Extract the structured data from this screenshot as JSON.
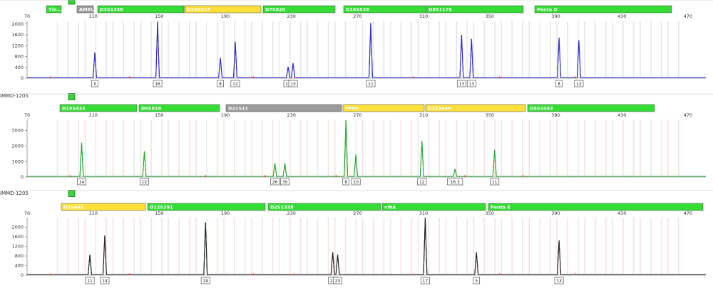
{
  "panels": [
    {
      "sample": "IMMD-1205",
      "color": "#2b2bc8",
      "markers": [
        {
          "label": "Yin...",
          "status": "green"
        },
        {
          "label": "AMEL",
          "status": "gray"
        },
        {
          "label": "D3S1358",
          "status": "green"
        },
        {
          "label": "D13S317",
          "status": "yellow"
        },
        {
          "label": "D7S820",
          "status": "green"
        },
        {
          "label": "D16S539",
          "status": "green"
        },
        {
          "label": "D8S1179",
          "status": "green"
        },
        {
          "label": "Penta D",
          "status": "green"
        }
      ],
      "x_ticks": [
        "70",
        "110",
        "150",
        "190",
        "230",
        "270",
        "310",
        "350",
        "390",
        "430",
        "470"
      ],
      "y_ticks": [
        "2000",
        "1600",
        "1200",
        "800",
        "400",
        "0"
      ],
      "ylim": [
        0,
        2100
      ],
      "peaks": [
        {
          "x": 111,
          "y": 950,
          "allele": "X"
        },
        {
          "x": 149,
          "y": 2100,
          "allele": "16"
        },
        {
          "x": 187,
          "y": 750,
          "allele": "8"
        },
        {
          "x": 196,
          "y": 1350,
          "allele": "12"
        },
        {
          "x": 228,
          "y": 420,
          "allele": "12"
        },
        {
          "x": 231,
          "y": 560,
          "allele": "13"
        },
        {
          "x": 278,
          "y": 2050,
          "allele": "11"
        },
        {
          "x": 333,
          "y": 1600,
          "allele": "13"
        },
        {
          "x": 339,
          "y": 1450,
          "allele": "13"
        },
        {
          "x": 392,
          "y": 1500,
          "allele": "8"
        },
        {
          "x": 404,
          "y": 1400,
          "allele": "12"
        }
      ]
    },
    {
      "sample": "IMMD-1205",
      "color": "#22aa33",
      "markers": [
        {
          "label": "D19S433",
          "status": "green"
        },
        {
          "label": "D5S818",
          "status": "green"
        },
        {
          "label": "D21S11",
          "status": "gray"
        },
        {
          "label": "TPOX",
          "status": "yellow"
        },
        {
          "label": "D1S1656",
          "status": "yellow"
        },
        {
          "label": "D6S1043",
          "status": "green"
        }
      ],
      "x_ticks": [
        "70",
        "110",
        "150",
        "190",
        "230",
        "270",
        "310",
        "350",
        "390",
        "430",
        "470"
      ],
      "y_ticks": [
        "3000",
        "2000",
        "1000",
        "0"
      ],
      "ylim": [
        0,
        3700
      ],
      "peaks": [
        {
          "x": 103,
          "y": 2200,
          "allele": "14"
        },
        {
          "x": 141,
          "y": 1650,
          "allele": "12"
        },
        {
          "x": 220,
          "y": 880,
          "allele": "26"
        },
        {
          "x": 226,
          "y": 880,
          "allele": "30"
        },
        {
          "x": 263,
          "y": 3650,
          "allele": "8"
        },
        {
          "x": 269,
          "y": 1450,
          "allele": "10"
        },
        {
          "x": 309,
          "y": 2300,
          "allele": "12"
        },
        {
          "x": 329,
          "y": 520,
          "allele": "16.3"
        },
        {
          "x": 353,
          "y": 1750,
          "allele": "11"
        }
      ]
    },
    {
      "sample": "IMMD-1205",
      "color": "#222222",
      "markers": [
        {
          "label": "D2S441",
          "status": "yellow"
        },
        {
          "label": "D12S391",
          "status": "green"
        },
        {
          "label": "D2S1338",
          "status": "green"
        },
        {
          "label": "vWA",
          "status": "green"
        },
        {
          "label": "Penta E",
          "status": "green"
        }
      ],
      "x_ticks": [
        "70",
        "110",
        "150",
        "190",
        "230",
        "270",
        "310",
        "350",
        "390",
        "430",
        "470"
      ],
      "y_ticks": [
        "2000",
        "1600",
        "1200",
        "800",
        "400",
        "0"
      ],
      "ylim": [
        0,
        2400
      ],
      "peaks": [
        {
          "x": 108,
          "y": 850,
          "allele": "11"
        },
        {
          "x": 117,
          "y": 1650,
          "allele": "14"
        },
        {
          "x": 178,
          "y": 2200,
          "allele": "19"
        },
        {
          "x": 255,
          "y": 950,
          "allele": "22"
        },
        {
          "x": 258,
          "y": 850,
          "allele": "23"
        },
        {
          "x": 311,
          "y": 2400,
          "allele": "17"
        },
        {
          "x": 342,
          "y": 950,
          "allele": "5"
        },
        {
          "x": 392,
          "y": 1450,
          "allele": "13"
        }
      ]
    }
  ],
  "chart_data": [
    {
      "type": "line",
      "sample": "IMMD-1205",
      "markers": [
        "Yin...",
        "AMEL",
        "D3S1358",
        "D13S317",
        "D7S820",
        "D16S539",
        "D8S1179",
        "Penta D"
      ],
      "x_ticks": [
        70,
        110,
        150,
        190,
        230,
        270,
        310,
        350,
        390,
        430,
        470
      ],
      "y_ticks": [
        0,
        400,
        800,
        1200,
        1600,
        2000
      ],
      "ylim": [
        0,
        2100
      ],
      "series": [
        {
          "x": [
            111,
            149,
            187,
            196,
            228,
            231,
            278,
            333,
            339,
            392,
            404
          ],
          "y": [
            950,
            2100,
            750,
            1350,
            420,
            560,
            2050,
            1600,
            1450,
            1500,
            1400
          ]
        }
      ],
      "alleles": [
        "X",
        "16",
        "8",
        "12",
        "12",
        "13",
        "11",
        "13",
        "13",
        "8",
        "12"
      ]
    },
    {
      "type": "line",
      "sample": "IMMD-1205",
      "markers": [
        "D19S433",
        "D5S818",
        "D21S11",
        "TPOX",
        "D1S1656",
        "D6S1043"
      ],
      "x_ticks": [
        70,
        110,
        150,
        190,
        230,
        270,
        310,
        350,
        390,
        430,
        470
      ],
      "y_ticks": [
        0,
        1000,
        2000,
        3000
      ],
      "ylim": [
        0,
        3700
      ],
      "series": [
        {
          "x": [
            103,
            141,
            220,
            226,
            263,
            269,
            309,
            329,
            353
          ],
          "y": [
            2200,
            1650,
            880,
            880,
            3650,
            1450,
            2300,
            520,
            1750
          ]
        }
      ],
      "alleles": [
        "14",
        "12",
        "26",
        "30",
        "8",
        "10",
        "12",
        "16.3",
        "11"
      ]
    },
    {
      "type": "line",
      "sample": "IMMD-1205",
      "markers": [
        "D2S441",
        "D12S391",
        "D2S1338",
        "vWA",
        "Penta E"
      ],
      "x_ticks": [
        70,
        110,
        150,
        190,
        230,
        270,
        310,
        350,
        390,
        430,
        470
      ],
      "y_ticks": [
        0,
        400,
        800,
        1200,
        1600,
        2000
      ],
      "ylim": [
        0,
        2400
      ],
      "series": [
        {
          "x": [
            108,
            117,
            178,
            255,
            258,
            311,
            342,
            392
          ],
          "y": [
            850,
            1650,
            2200,
            950,
            850,
            2400,
            950,
            1450
          ]
        }
      ],
      "alleles": [
        "11",
        "14",
        "19",
        "22",
        "23",
        "17",
        "5",
        "13"
      ]
    }
  ],
  "status_colors": {
    "green": "#33dd33",
    "yellow": "#ffe03a",
    "gray": "#9a9a9a"
  }
}
